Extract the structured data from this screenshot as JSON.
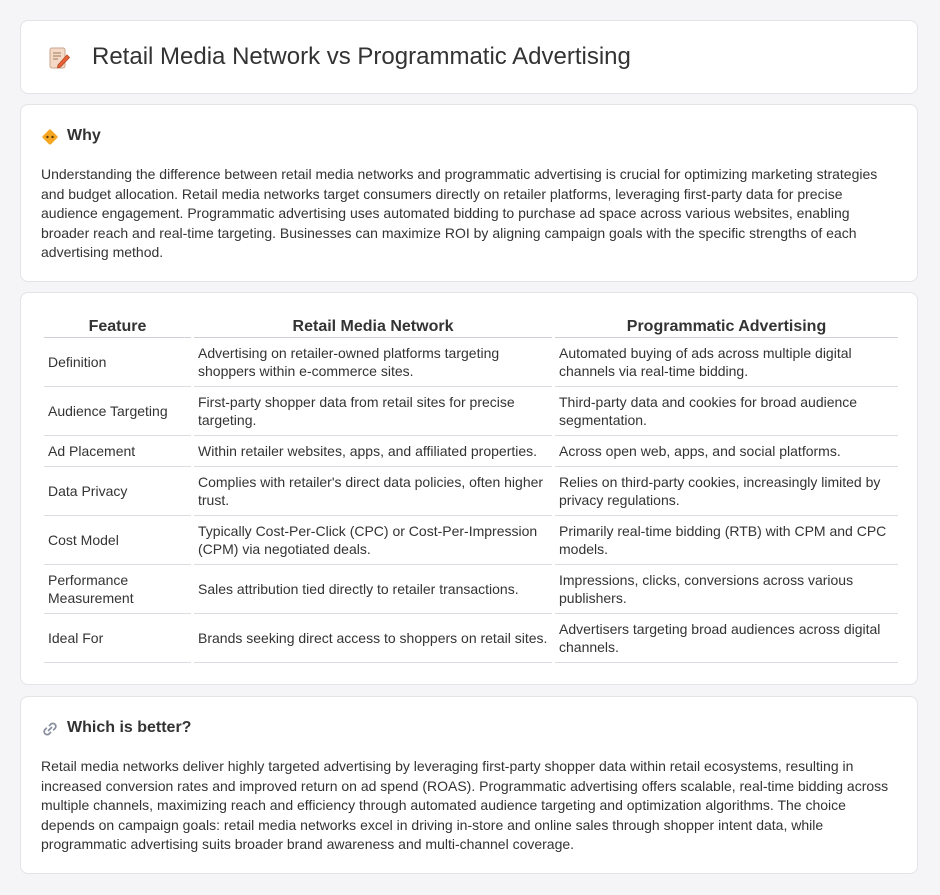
{
  "page": {
    "title": "Retail Media Network vs Programmatic Advertising",
    "title_icon": "edit-document-icon"
  },
  "why": {
    "icon": "diamond-warning-icon",
    "title": "Why",
    "text": "Understanding the difference between retail media networks and programmatic advertising is crucial for optimizing marketing strategies and budget allocation. Retail media networks target consumers directly on retailer platforms, leveraging first-party data for precise audience engagement. Programmatic advertising uses automated bidding to purchase ad space across various websites, enabling broader reach and real-time targeting. Businesses can maximize ROI by aligning campaign goals with the specific strengths of each advertising method."
  },
  "table": {
    "headers": [
      "Feature",
      "Retail Media Network",
      "Programmatic Advertising"
    ],
    "rows": [
      [
        "Definition",
        "Advertising on retailer-owned platforms targeting shoppers within e-commerce sites.",
        "Automated buying of ads across multiple digital channels via real-time bidding."
      ],
      [
        "Audience Targeting",
        "First-party shopper data from retail sites for precise targeting.",
        "Third-party data and cookies for broad audience segmentation."
      ],
      [
        "Ad Placement",
        "Within retailer websites, apps, and affiliated properties.",
        "Across open web, apps, and social platforms."
      ],
      [
        "Data Privacy",
        "Complies with retailer's direct data policies, often higher trust.",
        "Relies on third-party cookies, increasingly limited by privacy regulations."
      ],
      [
        "Cost Model",
        "Typically Cost-Per-Click (CPC) or Cost-Per-Impression (CPM) via negotiated deals.",
        "Primarily real-time bidding (RTB) with CPM and CPC models."
      ],
      [
        "Performance Measurement",
        "Sales attribution tied directly to retailer transactions.",
        "Impressions, clicks, conversions across various publishers."
      ],
      [
        "Ideal For",
        "Brands seeking direct access to shoppers on retail sites.",
        "Advertisers targeting broad audiences across digital channels."
      ]
    ]
  },
  "better": {
    "icon": "link-icon",
    "title": "Which is better?",
    "text": "Retail media networks deliver highly targeted advertising by leveraging first-party shopper data within retail ecosystems, resulting in increased conversion rates and improved return on ad spend (ROAS). Programmatic advertising offers scalable, real-time bidding across multiple channels, maximizing reach and efficiency through automated audience targeting and optimization algorithms. The choice depends on campaign goals: retail media networks excel in driving in-store and online sales through shopper intent data, while programmatic advertising suits broader brand awareness and multi-channel coverage."
  }
}
